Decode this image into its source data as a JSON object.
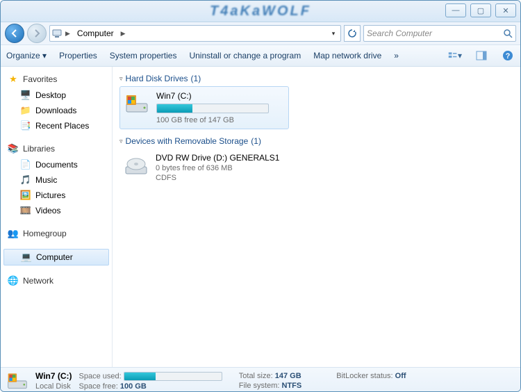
{
  "window": {
    "brand": "T4aKaWOLF"
  },
  "breadcrumb": {
    "root_icon": "computer",
    "segments": [
      "Computer"
    ]
  },
  "search": {
    "placeholder": "Search Computer"
  },
  "toolbar": {
    "organize": "Organize",
    "properties": "Properties",
    "system_properties": "System properties",
    "uninstall": "Uninstall or change a program",
    "map_drive": "Map network drive",
    "more": "»"
  },
  "nav": {
    "favorites": {
      "label": "Favorites",
      "items": [
        "Desktop",
        "Downloads",
        "Recent Places"
      ]
    },
    "libraries": {
      "label": "Libraries",
      "items": [
        "Documents",
        "Music",
        "Pictures",
        "Videos"
      ]
    },
    "homegroup": "Homegroup",
    "computer": "Computer",
    "network": "Network"
  },
  "sections": {
    "hdd": {
      "title": "Hard Disk Drives",
      "count": "(1)"
    },
    "removable": {
      "title": "Devices with Removable Storage",
      "count": "(1)"
    }
  },
  "drives": {
    "c": {
      "name": "Win7 (C:)",
      "sub": "100 GB free of 147 GB",
      "used_pct": 32
    },
    "d": {
      "name": "DVD RW Drive (D:) GENERALS1",
      "sub1": "0 bytes free of 636 MB",
      "sub2": "CDFS"
    }
  },
  "details": {
    "name": "Win7 (C:)",
    "type": "Local Disk",
    "used_label": "Space used:",
    "free_label": "Space free:",
    "free_value": "100 GB",
    "total_label": "Total size:",
    "total_value": "147 GB",
    "fs_label": "File system:",
    "fs_value": "NTFS",
    "bitlocker_label": "BitLocker status:",
    "bitlocker_value": "Off",
    "used_pct": 32
  }
}
